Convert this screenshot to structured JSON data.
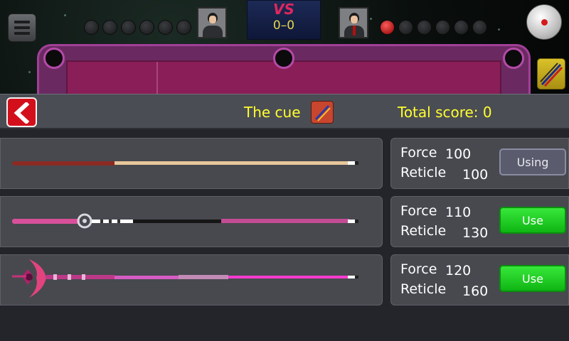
{
  "game": {
    "vs_label": "VS",
    "score": "0–0",
    "player1_pockets": [
      false,
      false,
      false,
      false,
      false,
      false
    ],
    "player2_pockets": [
      true,
      false,
      false,
      false,
      false,
      false
    ]
  },
  "panel": {
    "title": "The cue",
    "total_score": "Total score: 0"
  },
  "cues": [
    {
      "force_label": "Force",
      "force": "100",
      "reticle_label": "Reticle",
      "reticle": "100",
      "action": "Using",
      "state": "using"
    },
    {
      "force_label": "Force",
      "force": "110",
      "reticle_label": "Reticle",
      "reticle": "130",
      "action": "Use",
      "state": "available"
    },
    {
      "force_label": "Force",
      "force": "120",
      "reticle_label": "Reticle",
      "reticle": "160",
      "action": "Use",
      "state": "available"
    }
  ],
  "colors": {
    "title_yellow": "#ffff2e",
    "use_green": "#1fcc22",
    "using_gray": "#5a5c6d",
    "back_red": "#d40f1c"
  },
  "icons": [
    "menu-icon",
    "player-avatar",
    "cue-ball-icon",
    "cue-shop-icon",
    "back-arrow-icon",
    "cue-title-icon"
  ]
}
